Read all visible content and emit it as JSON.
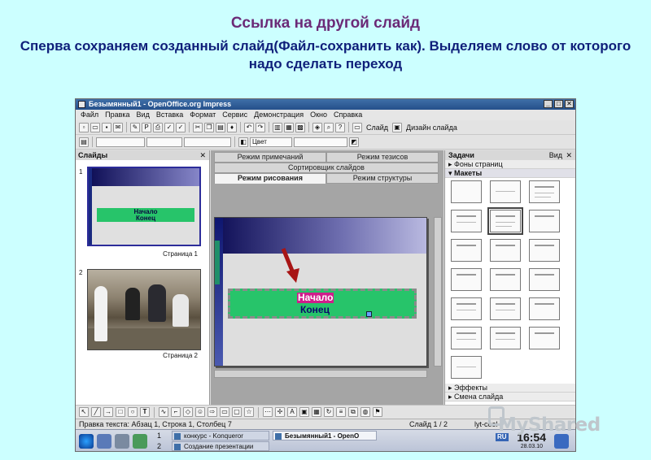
{
  "slide": {
    "title": "Ссылка на другой слайд",
    "subtitle": "Сперва сохраняем созданный слайд(Файл-сохранить как). Выделяем слово от которого надо сделать переход"
  },
  "window": {
    "title": "Безымянный1 - OpenOffice.org Impress"
  },
  "menu": [
    "Файл",
    "Правка",
    "Вид",
    "Вставка",
    "Формат",
    "Сервис",
    "Демонстрация",
    "Окно",
    "Справка"
  ],
  "toolbar": {
    "slide_label": "Слайд",
    "design_label": "Дизайн слайда",
    "color_combo": "Цвет"
  },
  "slides_pane": {
    "title": "Слайды",
    "close": "✕",
    "thumbs": [
      {
        "num": "1",
        "line1": "Начало",
        "line2": "Конец",
        "caption": "Страница 1"
      },
      {
        "num": "2",
        "caption": "Страница 2"
      }
    ]
  },
  "view_tabs": {
    "row1": [
      "Режим примечаний",
      "Режим тезисов"
    ],
    "row2": [
      "Сортировщик слайдов"
    ],
    "row3": [
      "Режим рисования",
      "Режим структуры"
    ]
  },
  "canvas": {
    "word1": "Начало",
    "word2": "Конец"
  },
  "task_pane": {
    "title": "Задачи",
    "view": "Вид",
    "close": "✕",
    "sections": {
      "master": "Фоны страниц",
      "layouts": "Макеты",
      "effects": "Эффекты",
      "transition": "Смена слайда"
    }
  },
  "status": {
    "text": "Правка текста: Абзац 1, Строка 1, Столбец 7",
    "slide": "Слайд 1 / 2",
    "layout": "lyt-cool"
  },
  "taskbar": {
    "desktop1": "1",
    "desktop2": "2",
    "task1": "конкурс - Konqueror",
    "task2": "Безымянный1 - OpenO",
    "task3": "Создание презентации",
    "lang": "RU",
    "time": "16:54",
    "date": "28.03.10"
  },
  "watermark": "MyShared"
}
